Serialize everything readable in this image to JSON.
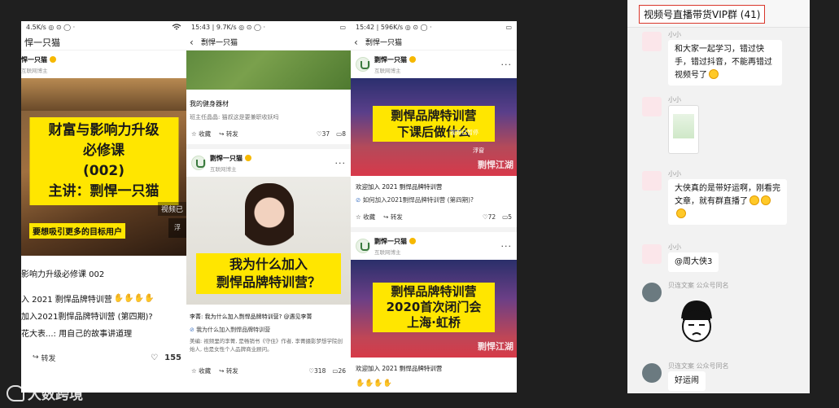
{
  "phone1": {
    "status_left": "4.5K/s ◎ ⊙ ◯ ·",
    "nav_title": "悍一只猫",
    "author_name": "悍一只猫",
    "author_sub": "互联网博主",
    "banner_lines": [
      "财富与影响力升级",
      "必修课",
      "(002)",
      "主讲：剽悍一只猫"
    ],
    "banner_sub": "要想吸引更多的目标用户",
    "banner_overlay": "视频已",
    "overlay_small": "浮",
    "post_title": "影响力升级必修课 002",
    "line1": "入 2021 剽悍品牌特训营",
    "line2": "加入2021剽悍品牌特训营 (第四期)?",
    "line3": "花大表...: 用自己的故事讲道理",
    "share_label": "转发",
    "like_count": "155"
  },
  "phone2": {
    "status_left": "15:43 | 9.7K/s ◎ ⊙ ◯ ·",
    "nav_title": "剽悍一只猫",
    "gym_title": "我的健身器材",
    "gym_comment": "班主任晶晶: 猫叔这是要兼职收妖吗",
    "fav_label": "收藏",
    "share_label": "转发",
    "like_count": "37",
    "comment_count": "8",
    "author_name": "剽悍一只猫",
    "author_sub": "互联网博主",
    "banner_lines": [
      "我为什么加入",
      "剽悍品牌特训营？"
    ],
    "post_author_line": "李菁: 我为什么加入剽悍品牌特训营? @遇见李菁",
    "post_link": "我为什么加入剽悍品牌特训营",
    "post_desc": "美编: 视频里的李菁, 是畅销书《守住》作者, 李菁摄影梦想学院创始人, 也是女性个人品牌商业顾问。",
    "like_count2": "318",
    "comment_count2": "26"
  },
  "phone3": {
    "status_left": "15:42 | 596K/s ◎ ⊙ ◯ ·",
    "nav_title": "剽悍一只猫",
    "author_name": "剽悍一只猫",
    "author_sub": "互联网博主",
    "banner1_lines": [
      "剽悍品牌特训营",
      "下课后做什么"
    ],
    "banner1_overlay": "视频已暂停",
    "banner1_float": "浮窗",
    "brand_mark": "剽悍江湖",
    "post1_title": "欢迎加入 2021 剽悍品牌特训营",
    "post1_link": "如何加入2021剽悍品牌特训营 (第四期)?",
    "fav_label": "收藏",
    "share_label": "转发",
    "like_count": "72",
    "comment_count": "5",
    "banner2_lines": [
      "剽悍品牌特训营",
      "2020首次闭门会",
      "上海·虹桥"
    ],
    "post2_title": "欢迎加入 2021 剽悍品牌特训营"
  },
  "chat": {
    "title": "视频号直播带货VIP群 (41)",
    "messages": [
      {
        "name": "小小",
        "text": "和大家一起学习，错过快手，错过抖音，不能再错过视频号了"
      },
      {
        "name": "小小",
        "text": ""
      },
      {
        "name": "小小",
        "text": "大侠真的是带好运啊，刚看完文章，就有群直播了"
      },
      {
        "name": "小小",
        "text": "@周大侠3"
      },
      {
        "name": "贝连文案 公众号同名",
        "text": ""
      },
      {
        "name": "贝连文案 公众号同名",
        "text": "好运闹"
      }
    ]
  },
  "watermark": {
    "text": "大数跨境"
  },
  "colors": {
    "banner_yellow": "#ffe600",
    "title_border": "#d9362b",
    "chat_bg": "#f2f2f2"
  }
}
